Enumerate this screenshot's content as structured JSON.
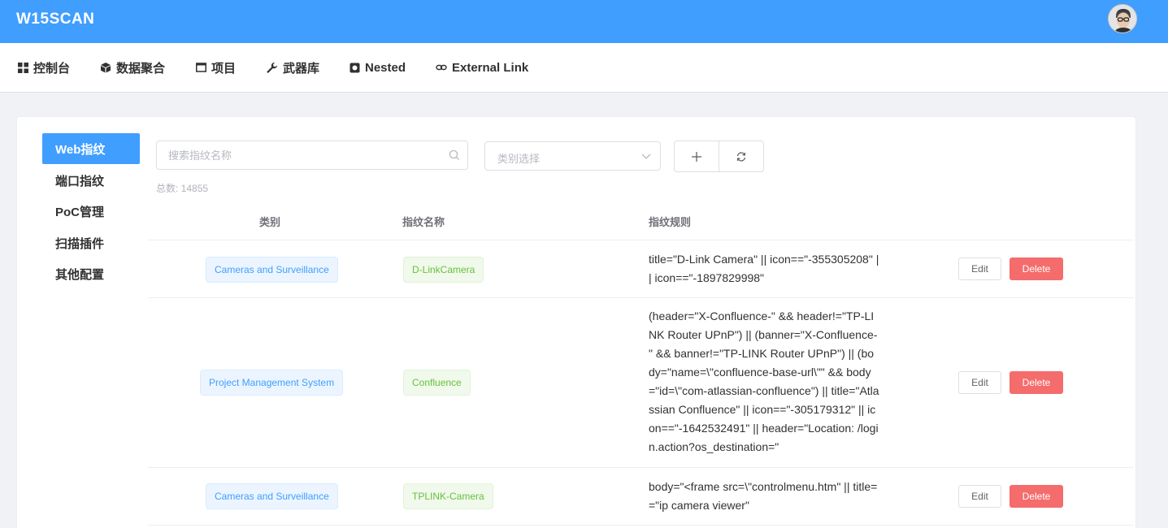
{
  "header": {
    "brand": "W15SCAN"
  },
  "nav": {
    "items": [
      {
        "label": "控制台",
        "icon": "grid-icon"
      },
      {
        "label": "数据聚合",
        "icon": "cube-icon"
      },
      {
        "label": "项目",
        "icon": "window-icon"
      },
      {
        "label": "武器库",
        "icon": "wrench-icon"
      },
      {
        "label": "Nested",
        "icon": "record-icon"
      },
      {
        "label": "External Link",
        "icon": "link-icon"
      }
    ]
  },
  "sidebar": {
    "items": [
      {
        "label": "Web指纹",
        "active": true
      },
      {
        "label": "端口指纹",
        "active": false
      },
      {
        "label": "PoC管理",
        "active": false
      },
      {
        "label": "扫描插件",
        "active": false
      },
      {
        "label": "其他配置",
        "active": false
      }
    ]
  },
  "toolbar": {
    "search_placeholder": "搜索指纹名称",
    "select_placeholder": "类别选择",
    "total": "总数: 14855"
  },
  "table": {
    "columns": [
      "类别",
      "指纹名称",
      "指纹规则"
    ],
    "edit_label": "Edit",
    "delete_label": "Delete",
    "rows": [
      {
        "category": "Cameras and Surveillance",
        "name": "D-LinkCamera",
        "rule": "title=\"D-Link Camera\" || icon==\"-355305208\" || icon==\"-1897829998\""
      },
      {
        "category": "Project Management System",
        "name": "Confluence",
        "rule": "(header=\"X-Confluence-\" && header!=\"TP-LINK Router UPnP\") || (banner=\"X-Confluence-\" && banner!=\"TP-LINK Router UPnP\") || (body=\"name=\\\"confluence-base-url\\\"\" && body=\"id=\\\"com-atlassian-confluence\") || title=\"Atlassian Confluence\" || icon==\"-305179312\" || icon==\"-1642532491\" || header=\"Location: /login.action?os_destination=\""
      },
      {
        "category": "Cameras and Surveillance",
        "name": "TPLINK-Camera",
        "rule": "body=\"<frame src=\\\"controlmenu.htm\" || title==\"ip camera viewer\""
      }
    ]
  },
  "colors": {
    "primary": "#409eff",
    "danger": "#f56c6c",
    "success": "#67c23a"
  }
}
